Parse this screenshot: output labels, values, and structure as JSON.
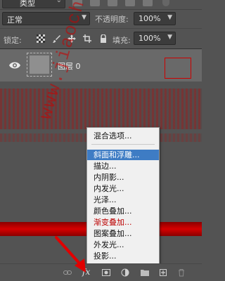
{
  "filter": {
    "kind_label": "类型"
  },
  "blend": {
    "mode_value": "正常",
    "opacity_label": "不透明度:",
    "opacity_value": "100%"
  },
  "lock": {
    "label": "锁定:",
    "fill_label": "填充:",
    "fill_value": "100%"
  },
  "layer": {
    "name": "图层 0"
  },
  "watermark": "www.jiaochengzhijia.com",
  "menu": {
    "items": [
      "混合选项...",
      "斜面和浮雕...",
      "描边...",
      "内阴影...",
      "内发光...",
      "光泽...",
      "颜色叠加...",
      "渐变叠加...",
      "图案叠加...",
      "外发光...",
      "投影..."
    ],
    "selected_index": 1
  },
  "colors": {
    "panel": "#535353",
    "menu_bg": "#f0f0f0",
    "selection": "#3e7cc4",
    "red": "#cc0000"
  }
}
